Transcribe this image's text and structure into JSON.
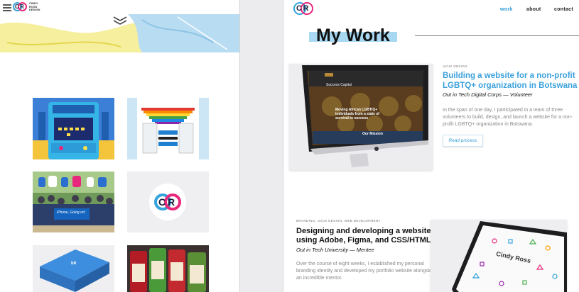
{
  "colors": {
    "accent_blue": "#2a9ad6",
    "light_blue": "#a8d8f2",
    "logo_pink": "#e8287c",
    "logo_blue": "#35a3dc",
    "navy": "#1b1f3a"
  },
  "left_page": {
    "logo": {
      "initials_c": "C",
      "initials_r": "R",
      "text_lines": [
        "CINDY",
        "ROSS",
        "DESIGN"
      ]
    },
    "menu_icon": "hamburger-icon",
    "scroll_icon": "double-chevron-down-icon",
    "tiles": [
      {
        "name": "tile-arcade"
      },
      {
        "name": "tile-lgbtq-building"
      },
      {
        "name": "tile-group-photo",
        "banner_text": "iPhone, Going on!"
      },
      {
        "name": "tile-cr-logo",
        "initials_c": "C",
        "initials_r": "R"
      },
      {
        "name": "tile-bit-box",
        "box_text": "bit"
      },
      {
        "name": "tile-juice-bottles"
      }
    ]
  },
  "right_page": {
    "logo": {
      "initials_c": "C",
      "initials_r": "R"
    },
    "nav": [
      {
        "label": "work",
        "active": true
      },
      {
        "label": "about",
        "active": false
      },
      {
        "label": "contact",
        "active": false
      }
    ],
    "page_title": "My Work",
    "projects": [
      {
        "tag": "UI/UX DESIGN",
        "title": "Building a website for a non-profit LGBTQ+ organization in Botswana",
        "subtitle": "Out in Tech Digital Corps — Volunteer",
        "description": "In the span of one day, I participated in a team of three volunteers to build, design, and launch a website for a non-profit LGBTQ+ organization in Botswana.",
        "button": "Read process",
        "screen": {
          "site_name": "Success Capital",
          "hero_text": "Moving African LGBTIQ+ individuals from a state of survival to success",
          "section_text": "Our Mission"
        }
      },
      {
        "tag": "BRANDING, UI/UX DESIGN, WEB DEVELOPMENT",
        "title": "Designing and developing a website using Adobe, Figma, and CSS/HTML",
        "subtitle": "Out in Tech University — Mentee",
        "description": "Over the course of eight weeks, I established my personal branding identity and developed my portfolio website alongside an incredible mentor.",
        "screen": {
          "name_text": "Cindy Ross"
        }
      }
    ]
  }
}
